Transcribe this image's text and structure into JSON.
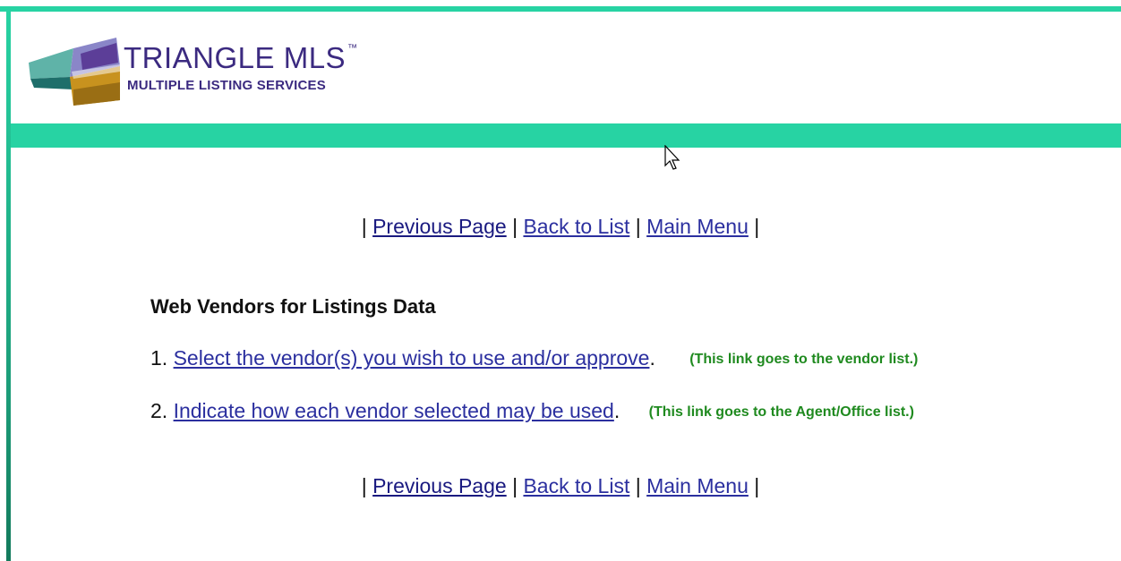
{
  "header": {
    "logo_title": "TRIANGLE MLS",
    "logo_tm": "™",
    "logo_subtitle": "MULTIPLE LISTING SERVICES"
  },
  "nav": {
    "previous_page": "Previous Page",
    "back_to_list": "Back to List",
    "main_menu": "Main Menu",
    "separator": "|"
  },
  "main": {
    "title": "Web Vendors for Listings Data",
    "items": [
      {
        "number": "1.",
        "link": "Select the vendor(s) you wish to use and/or approve",
        "punct": ".",
        "note": "(This link goes to the vendor list.)"
      },
      {
        "number": "2.",
        "link": "Indicate how each vendor selected may be used",
        "punct": ".",
        "note": "(This link goes to the Agent/Office list.)"
      }
    ]
  },
  "colors": {
    "accent": "#27d3a3",
    "link": "#2b2f9f",
    "note": "#1f8a1f",
    "logo_text": "#3b2a80"
  }
}
